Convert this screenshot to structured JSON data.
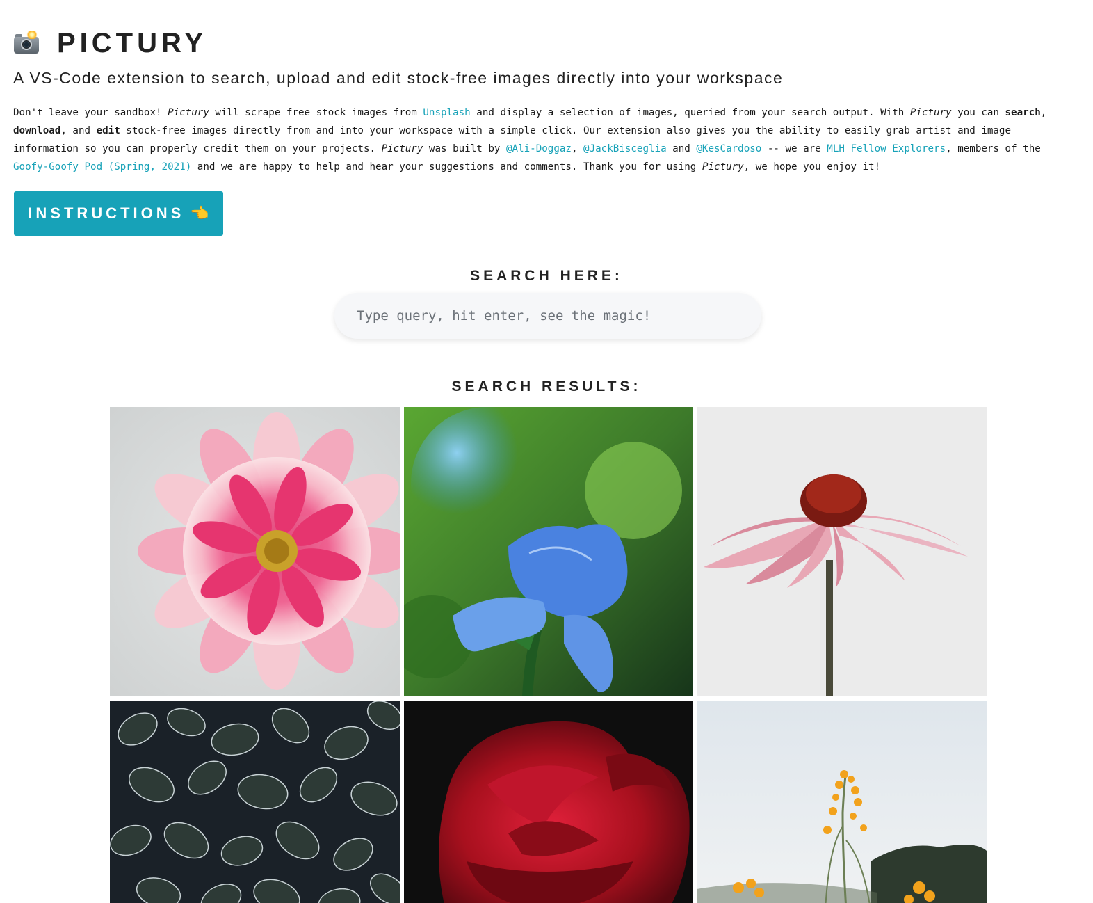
{
  "header": {
    "title": "PICTURY",
    "title_icon": "camera-flash-icon",
    "subtitle": "A VS-Code extension to search, upload and edit stock-free images directly into your workspace"
  },
  "description": {
    "part1": "Don't leave your sandbox! ",
    "pictury": "Pictury",
    "part2": " will scrape free stock images from ",
    "unsplash_link": "Unsplash",
    "part3": " and display a selection of images, queried from your search output. With ",
    "part4": " you can ",
    "search": "search",
    "comma1": ", ",
    "download": "download",
    "comma2": ", and ",
    "edit": "edit",
    "part5": " stock-free images directly from and into your workspace with a simple click. Our extension also gives you the ability to easily grab artist and image information so you can properly credit them on your projects. ",
    "part6": " was built by ",
    "author1": "@Ali-Doggaz",
    "comma3": ", ",
    "author2": "@JackBisceglia",
    "and": " and ",
    "author3": "@KesCardoso",
    "part7": " -- we are ",
    "mlh_link": "MLH Fellow Explorers",
    "part8": ", members of the ",
    "pod_link": "Goofy-Goofy Pod (Spring, 2021)",
    "part9": " and we are happy to help and hear your suggestions and comments. Thank you for using ",
    "part10": ", we hope you enjoy it!"
  },
  "instructions_button": {
    "label": "INSTRUCTIONS",
    "icon": "pointing-hand-icon",
    "glyph": "👈"
  },
  "search": {
    "heading": "SEARCH HERE:",
    "placeholder": "Type query, hit enter, see the magic!",
    "value": ""
  },
  "results": {
    "heading": "SEARCH RESULTS:",
    "images": [
      {
        "name": "pink-dahlia-image"
      },
      {
        "name": "blue-iris-image"
      },
      {
        "name": "pink-coneflower-image"
      },
      {
        "name": "fittonia-leaves-image"
      },
      {
        "name": "red-rose-image"
      },
      {
        "name": "yellow-wildflower-image"
      }
    ]
  },
  "colors": {
    "accent": "#17a2b8",
    "text": "#222222",
    "input_bg": "#f6f7f9"
  }
}
